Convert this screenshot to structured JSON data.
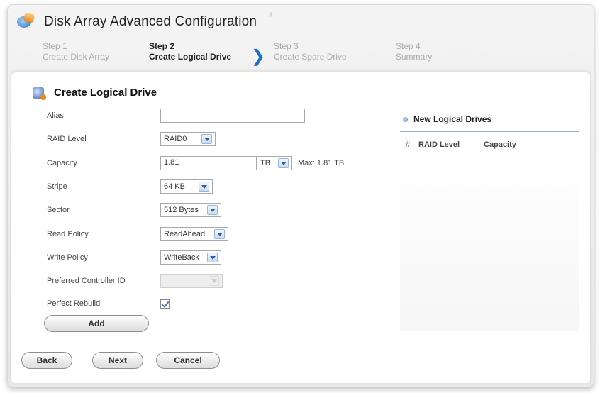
{
  "header": {
    "title": "Disk Array Advanced Configuration",
    "help_icon": "help-icon"
  },
  "steps": [
    {
      "num": "Step 1",
      "label": "Create Disk Array"
    },
    {
      "num": "Step 2",
      "label": "Create Logical Drive"
    },
    {
      "num": "Step 3",
      "label": "Create Spare Drive"
    },
    {
      "num": "Step 4",
      "label": "Summary"
    }
  ],
  "card": {
    "title": "Create Logical Drive"
  },
  "form": {
    "alias": {
      "label": "Alias",
      "value": ""
    },
    "raid_level": {
      "label": "RAID Level",
      "value": "RAID0"
    },
    "capacity": {
      "label": "Capacity",
      "value": "1.81",
      "unit": "TB",
      "max": "Max: 1.81 TB"
    },
    "stripe": {
      "label": "Stripe",
      "value": "64 KB"
    },
    "sector": {
      "label": "Sector",
      "value": "512 Bytes"
    },
    "read_policy": {
      "label": "Read Policy",
      "value": "ReadAhead"
    },
    "write_policy": {
      "label": "Write Policy",
      "value": "WriteBack"
    },
    "preferred_controller": {
      "label": "Preferred Controller ID",
      "value": ""
    },
    "perfect_rebuild": {
      "label": "Perfect Rebuild",
      "checked": true
    },
    "add_label": "Add"
  },
  "right_panel": {
    "title": "New Logical Drives",
    "columns": [
      "#",
      "RAID Level",
      "Capacity"
    ]
  },
  "buttons": {
    "back": "Back",
    "next": "Next",
    "cancel": "Cancel"
  }
}
